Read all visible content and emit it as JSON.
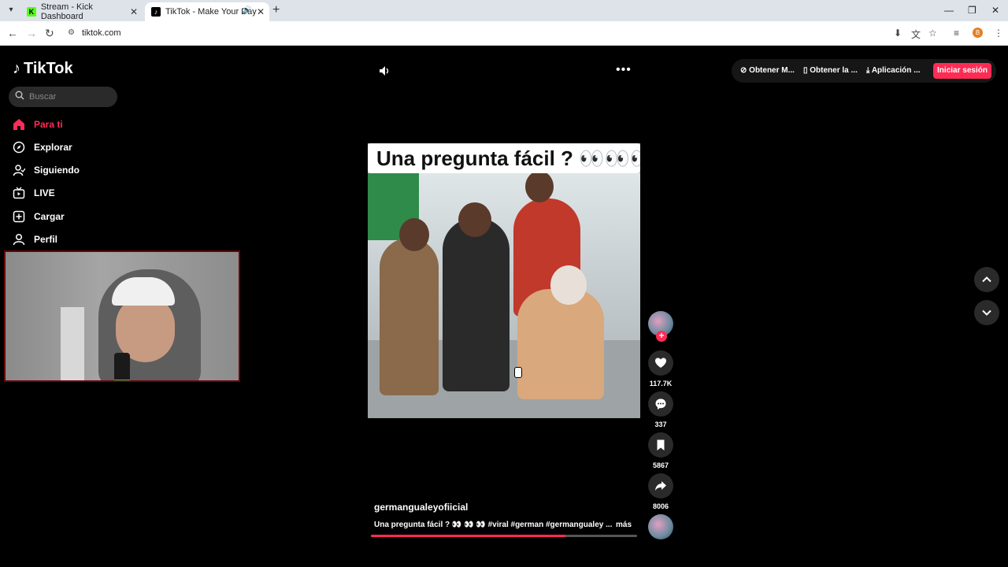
{
  "browser": {
    "tabs": [
      {
        "title": "Stream - Kick Dashboard",
        "favicon": "K"
      },
      {
        "title": "TikTok - Make Your Day",
        "favicon": "♪"
      }
    ],
    "url": "tiktok.com",
    "profile_initial": "B"
  },
  "app": {
    "brand": "TikTok",
    "search_placeholder": "Buscar",
    "accent_color": "#fe2c55"
  },
  "sidebar": {
    "items": [
      {
        "label": "Para ti",
        "icon": "home-icon",
        "active": true
      },
      {
        "label": "Explorar",
        "icon": "compass-icon",
        "active": false
      },
      {
        "label": "Siguiendo",
        "icon": "following-icon",
        "active": false
      },
      {
        "label": "LIVE",
        "icon": "live-icon",
        "active": false
      },
      {
        "label": "Cargar",
        "icon": "upload-icon",
        "active": false
      },
      {
        "label": "Perfil",
        "icon": "profile-icon",
        "active": false
      }
    ]
  },
  "header": {
    "actions": [
      "Obtener M...",
      "Obtener la ...",
      "Aplicación ..."
    ],
    "login_label": "Iniciar sesión"
  },
  "video": {
    "overlay_caption": "Una pregunta fácil ? 👀👀👀",
    "author": "germangualeyofiicial",
    "description": "Una pregunta fácil ? 👀 👀 👀 #viral #german #germangualey ...",
    "more_label": "más",
    "progress": 0.73,
    "likes": "117.7K",
    "comments": "337",
    "saves": "5867",
    "shares": "8006"
  }
}
